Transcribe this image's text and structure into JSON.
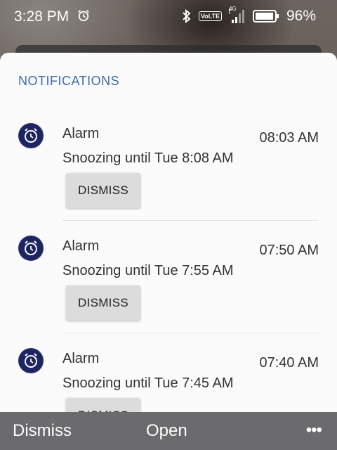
{
  "status_bar": {
    "time": "3:28 PM",
    "network_badge": "VoLTE",
    "network_type": "4G",
    "battery_percent": "96%",
    "battery_level": 0.96
  },
  "panel": {
    "title": "NOTIFICATIONS"
  },
  "notifications": [
    {
      "title": "Alarm",
      "text": "Snoozing until Tue 8:08 AM",
      "time": "08:03 AM",
      "action": "DISMISS"
    },
    {
      "title": "Alarm",
      "text": "Snoozing until Tue 7:55 AM",
      "time": "07:50 AM",
      "action": "DISMISS"
    },
    {
      "title": "Alarm",
      "text": "Snoozing until Tue 7:45 AM",
      "time": "07:40 AM",
      "action": "DISMISS"
    }
  ],
  "bottom_bar": {
    "dismiss_label": "Dismiss",
    "open_label": "Open",
    "more_label": "•••"
  },
  "colors": {
    "accent": "#3c6aa8",
    "icon_bg": "#1d2460",
    "bottom_bar": "#6b6b6e"
  }
}
